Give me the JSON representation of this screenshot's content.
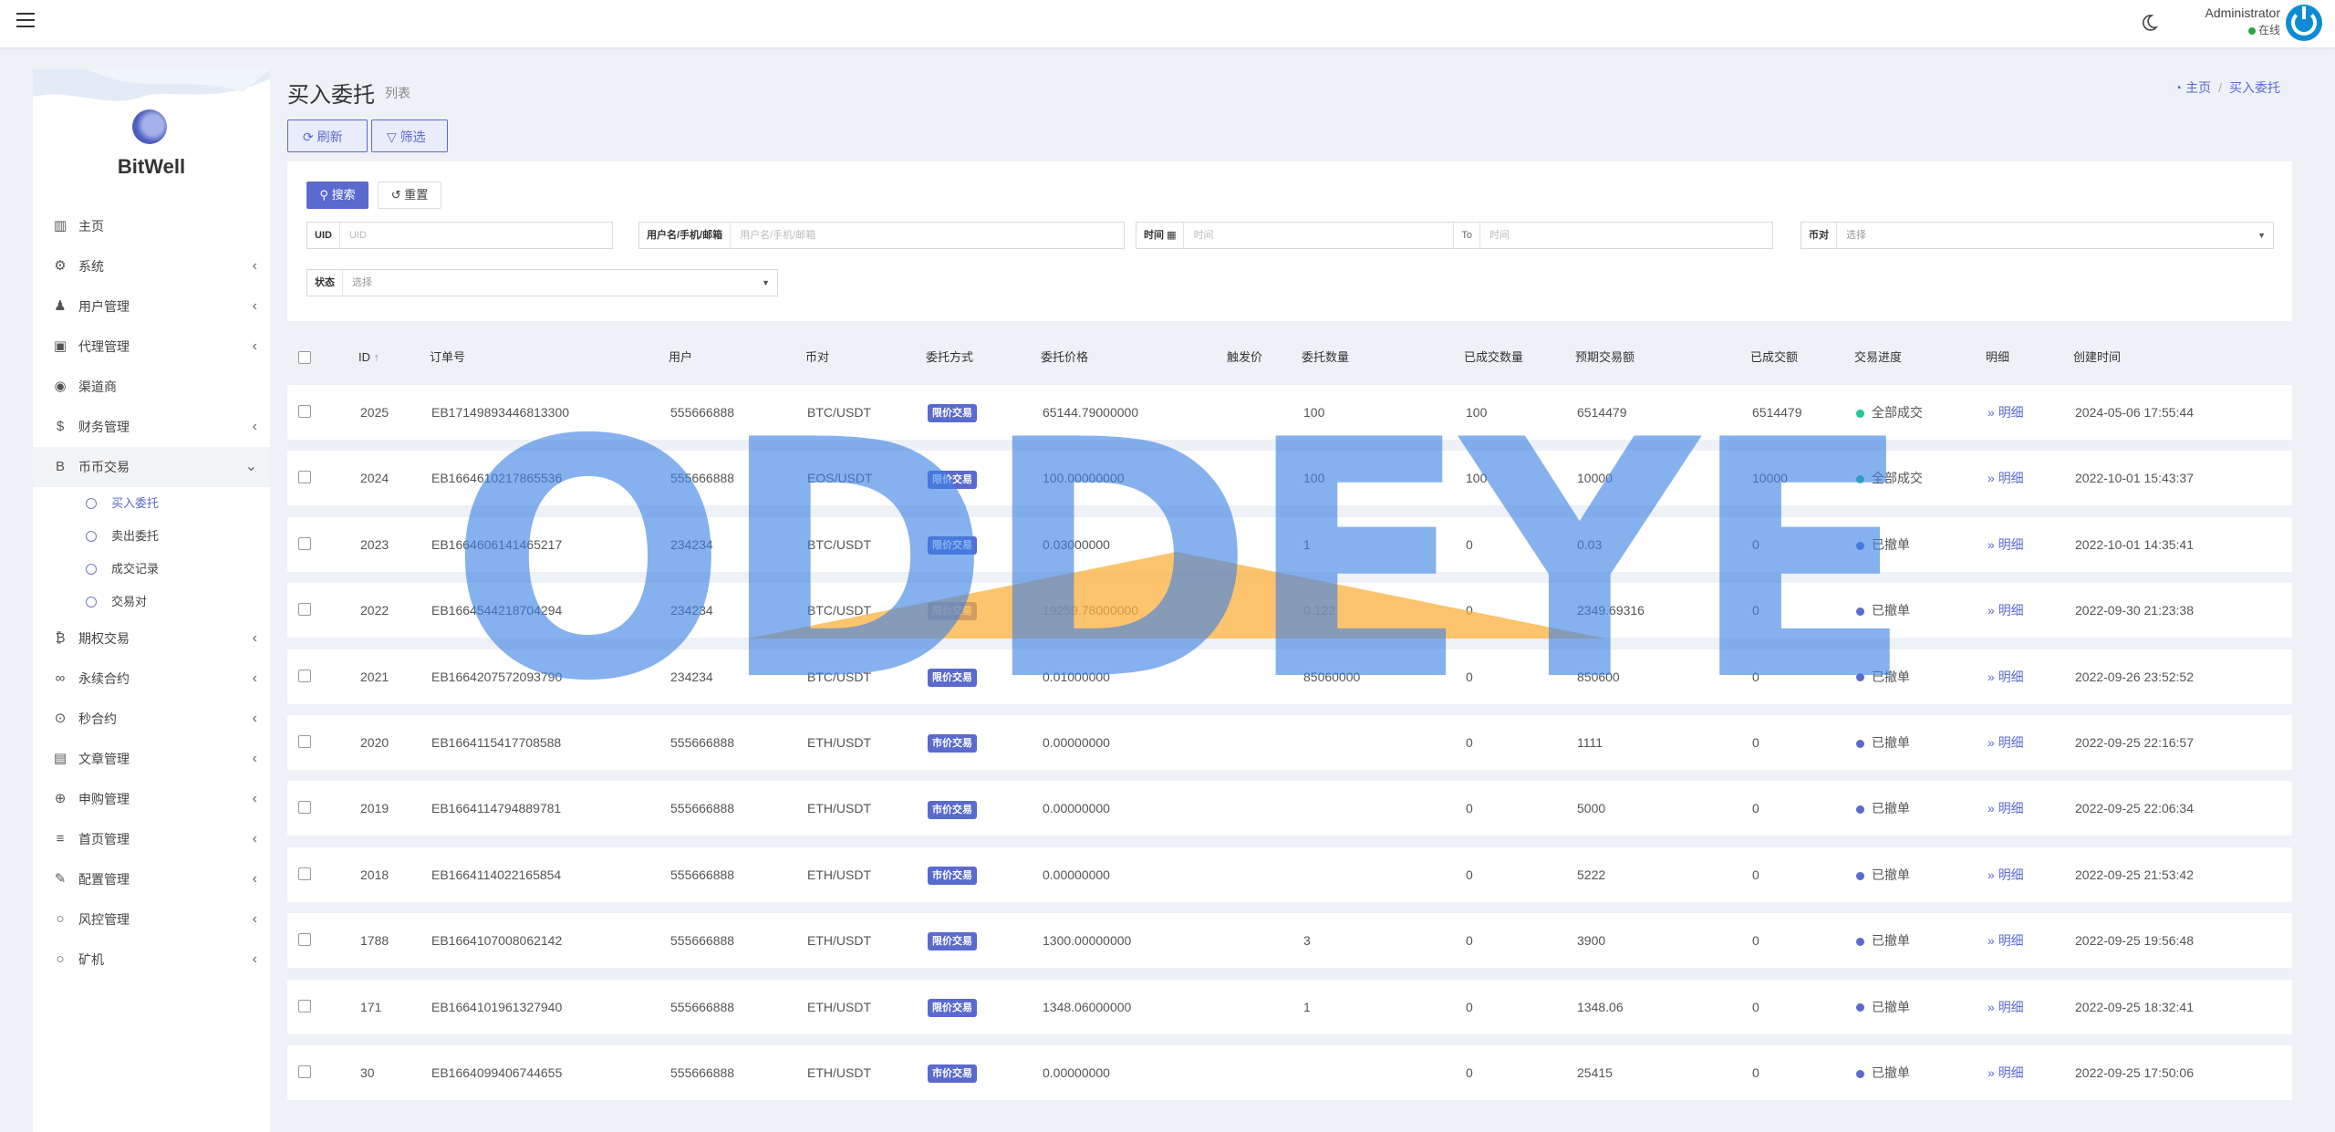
{
  "header": {
    "user_name": "Administrator",
    "user_status": "在线"
  },
  "sidebar": {
    "brand": "BitWell",
    "items": [
      {
        "label": "主页",
        "icon": "bar-chart-icon",
        "chevron": false
      },
      {
        "label": "系统",
        "icon": "gear-icon",
        "chevron": true
      },
      {
        "label": "用户管理",
        "icon": "user-tie-icon",
        "chevron": true
      },
      {
        "label": "代理管理",
        "icon": "id-card-icon",
        "chevron": true
      },
      {
        "label": "渠道商",
        "icon": "user-circle-icon",
        "chevron": false
      },
      {
        "label": "财务管理",
        "icon": "dollar-icon",
        "chevron": true
      },
      {
        "label": "币币交易",
        "icon": "bitcoin-b-icon",
        "chevron": true,
        "expanded": true
      }
    ],
    "sub_items": [
      {
        "label": "买入委托",
        "active": true
      },
      {
        "label": "卖出委托",
        "active": false
      },
      {
        "label": "成交记录",
        "active": false
      },
      {
        "label": "交易对",
        "active": false
      }
    ],
    "items_after": [
      {
        "label": "期权交易",
        "icon": "bitcoin-icon",
        "chevron": true
      },
      {
        "label": "永续合约",
        "icon": "link-icon",
        "chevron": true
      },
      {
        "label": "秒合约",
        "icon": "dot-circle-icon",
        "chevron": true
      },
      {
        "label": "文章管理",
        "icon": "newspaper-icon",
        "chevron": true
      },
      {
        "label": "申购管理",
        "icon": "life-ring-icon",
        "chevron": true
      },
      {
        "label": "首页管理",
        "icon": "list-icon",
        "chevron": true
      },
      {
        "label": "配置管理",
        "icon": "wrench-icon",
        "chevron": true
      },
      {
        "label": "风控管理",
        "icon": "circle-icon",
        "chevron": true
      },
      {
        "label": "矿机",
        "icon": "circle-icon",
        "chevron": true
      }
    ]
  },
  "page": {
    "title": "买入委托",
    "subtitle": "列表",
    "breadcrumb_home": "主页",
    "breadcrumb_current": "买入委托",
    "refresh_label": "刷新",
    "filter_label": "筛选"
  },
  "filters": {
    "search_label": "搜索",
    "reset_label": "重置",
    "uid_label": "UID",
    "uid_placeholder": "UID",
    "user_label": "用户名/手机/邮箱",
    "user_placeholder": "用户名/手机/邮箱",
    "time_label": "时间",
    "time_placeholder": "时间",
    "to_label": "To",
    "time_to_placeholder": "时间",
    "pair_label": "币对",
    "pair_value": "选择",
    "status_label": "状态",
    "status_value": "选择"
  },
  "table": {
    "columns": [
      "ID",
      "订单号",
      "用户",
      "币对",
      "委托方式",
      "委托价格",
      "触发价",
      "委托数量",
      "已成交数量",
      "预期交易额",
      "已成交额",
      "交易进度",
      "明细",
      "创建时间"
    ],
    "detail_label": "明细",
    "rows": [
      {
        "id": "2025",
        "order": "EB17149893446813300",
        "user": "555666888",
        "pair": "BTC/USDT",
        "type": "限价交易",
        "price": "65144.79000000",
        "trigger": "",
        "qty": "100",
        "filled_qty": "100",
        "expected": "6514479",
        "filled_amt": "6514479",
        "status": "全部成交",
        "status_color": "#20c997",
        "created": "2024-05-06 17:55:44"
      },
      {
        "id": "2024",
        "order": "EB1664610217865536",
        "user": "555666888",
        "pair": "EOS/USDT",
        "type": "限价交易",
        "price": "100.00000000",
        "trigger": "",
        "qty": "100",
        "filled_qty": "100",
        "expected": "10000",
        "filled_amt": "10000",
        "status": "全部成交",
        "status_color": "#20c997",
        "created": "2022-10-01 15:43:37"
      },
      {
        "id": "2023",
        "order": "EB1664606141465217",
        "user": "234234",
        "pair": "BTC/USDT",
        "type": "限价交易",
        "price": "0.03000000",
        "trigger": "",
        "qty": "1",
        "filled_qty": "0",
        "expected": "0.03",
        "filled_amt": "0",
        "status": "已撤单",
        "status_color": "#5a6acf",
        "created": "2022-10-01 14:35:41"
      },
      {
        "id": "2022",
        "order": "EB1664544218704294",
        "user": "234234",
        "pair": "BTC/USDT",
        "type": "限价交易",
        "price": "19259.78000000",
        "trigger": "",
        "qty": "0.122",
        "filled_qty": "0",
        "expected": "2349.69316",
        "filled_amt": "0",
        "status": "已撤单",
        "status_color": "#5a6acf",
        "created": "2022-09-30 21:23:38"
      },
      {
        "id": "2021",
        "order": "EB1664207572093790",
        "user": "234234",
        "pair": "BTC/USDT",
        "type": "限价交易",
        "price": "0.01000000",
        "trigger": "",
        "qty": "85060000",
        "filled_qty": "0",
        "expected": "850600",
        "filled_amt": "0",
        "status": "已撤单",
        "status_color": "#5a6acf",
        "created": "2022-09-26 23:52:52"
      },
      {
        "id": "2020",
        "order": "EB1664115417708588",
        "user": "555666888",
        "pair": "ETH/USDT",
        "type": "市价交易",
        "price": "0.00000000",
        "trigger": "",
        "qty": "",
        "filled_qty": "0",
        "expected": "1111",
        "filled_amt": "0",
        "status": "已撤单",
        "status_color": "#5a6acf",
        "created": "2022-09-25 22:16:57"
      },
      {
        "id": "2019",
        "order": "EB1664114794889781",
        "user": "555666888",
        "pair": "ETH/USDT",
        "type": "市价交易",
        "price": "0.00000000",
        "trigger": "",
        "qty": "",
        "filled_qty": "0",
        "expected": "5000",
        "filled_amt": "0",
        "status": "已撤单",
        "status_color": "#5a6acf",
        "created": "2022-09-25 22:06:34"
      },
      {
        "id": "2018",
        "order": "EB1664114022165854",
        "user": "555666888",
        "pair": "ETH/USDT",
        "type": "市价交易",
        "price": "0.00000000",
        "trigger": "",
        "qty": "",
        "filled_qty": "0",
        "expected": "5222",
        "filled_amt": "0",
        "status": "已撤单",
        "status_color": "#5a6acf",
        "created": "2022-09-25 21:53:42"
      },
      {
        "id": "1788",
        "order": "EB1664107008062142",
        "user": "555666888",
        "pair": "ETH/USDT",
        "type": "限价交易",
        "price": "1300.00000000",
        "trigger": "",
        "qty": "3",
        "filled_qty": "0",
        "expected": "3900",
        "filled_amt": "0",
        "status": "已撤单",
        "status_color": "#5a6acf",
        "created": "2022-09-25 19:56:48"
      },
      {
        "id": "171",
        "order": "EB1664101961327940",
        "user": "555666888",
        "pair": "ETH/USDT",
        "type": "限价交易",
        "price": "1348.06000000",
        "trigger": "",
        "qty": "1",
        "filled_qty": "0",
        "expected": "1348.06",
        "filled_amt": "0",
        "status": "已撤单",
        "status_color": "#5a6acf",
        "created": "2022-09-25 18:32:41"
      },
      {
        "id": "30",
        "order": "EB1664099406744655",
        "user": "555666888",
        "pair": "ETH/USDT",
        "type": "市价交易",
        "price": "0.00000000",
        "trigger": "",
        "qty": "",
        "filled_qty": "0",
        "expected": "25415",
        "filled_amt": "0",
        "status": "已撤单",
        "status_color": "#5a6acf",
        "created": "2022-09-25 17:50:06"
      }
    ]
  },
  "watermark": {
    "text": "ODDEYE"
  },
  "colors": {
    "accent": "#5a6acf",
    "success": "#20c997",
    "watermark_blue": "#3d82e6",
    "watermark_orange": "#fbb03b"
  }
}
